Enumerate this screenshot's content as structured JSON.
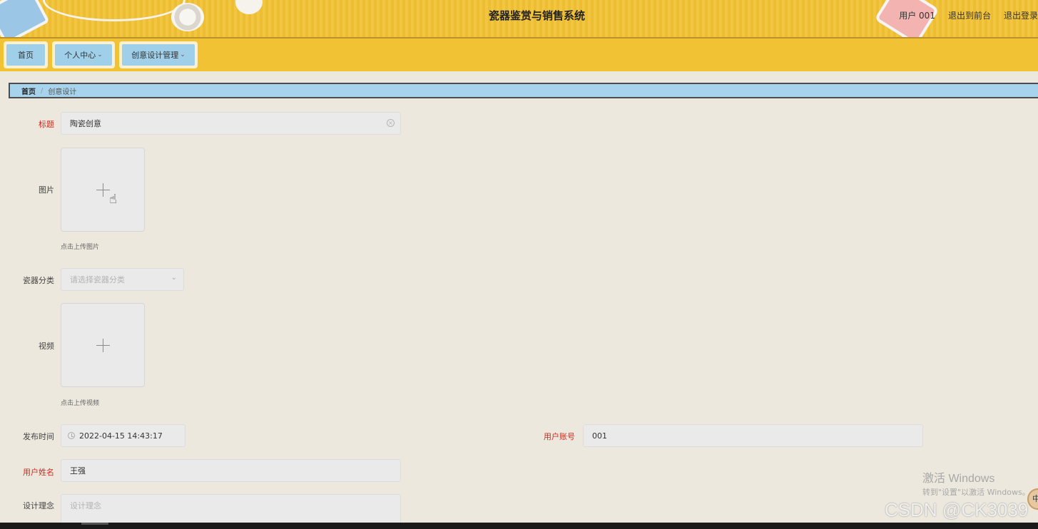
{
  "header": {
    "title": "瓷器鉴赏与销售系统",
    "user_label": "用户 001",
    "back_front_label": "退出到前台",
    "logout_label": "退出登录"
  },
  "nav": {
    "items": [
      {
        "label": "首页"
      },
      {
        "label": "个人中心"
      },
      {
        "label": "创意设计管理"
      }
    ]
  },
  "breadcrumb": {
    "home": "首页",
    "separator": "/",
    "current": "创意设计"
  },
  "form": {
    "title": {
      "label": "标题",
      "value": "陶瓷创意"
    },
    "image": {
      "label": "图片",
      "tip": "点击上传图片"
    },
    "category": {
      "label": "瓷器分类",
      "placeholder": "请选择瓷器分类"
    },
    "video": {
      "label": "视频",
      "tip": "点击上传视频"
    },
    "publish_time": {
      "label": "发布时间",
      "value": "2022-04-15 14:43:17"
    },
    "user_account": {
      "label": "用户账号",
      "value": "001"
    },
    "user_name": {
      "label": "用户姓名",
      "value": "王强"
    },
    "design_concept": {
      "label": "设计理念",
      "placeholder": "设计理念"
    }
  },
  "watermarks": {
    "windows_line1": "激活 Windows",
    "windows_line2": "转到\"设置\"以激活 Windows。",
    "csdn": "CSDN @CK3039",
    "float_char": "中"
  },
  "colors": {
    "header_bg": "#f2c235",
    "nav_button": "#9fcfe9",
    "breadcrumb_bg": "#a7d3ec",
    "page_bg": "#ede8dd",
    "required_label": "#d5271a"
  }
}
